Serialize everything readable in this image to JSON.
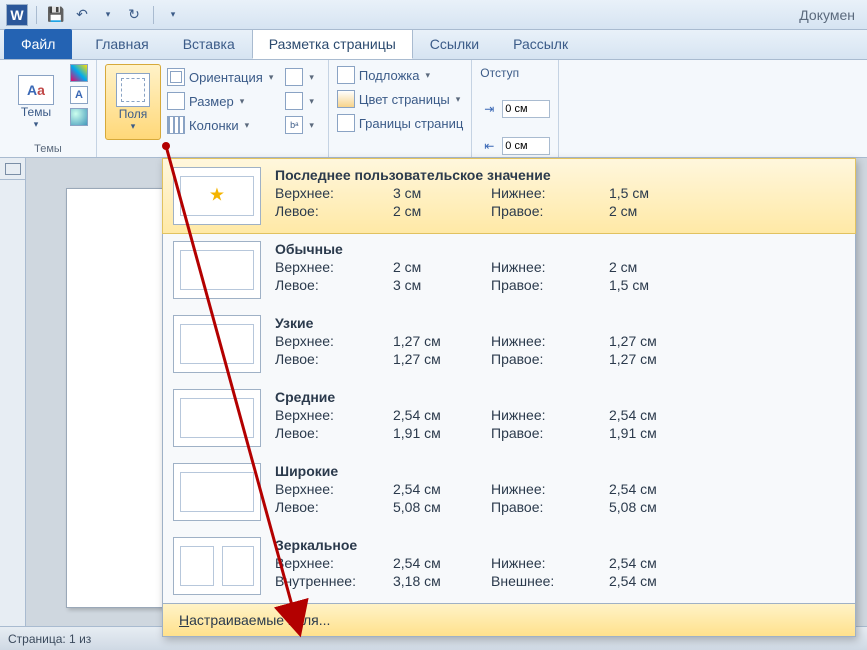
{
  "title": "Докумен",
  "tabs": {
    "file": "Файл",
    "home": "Главная",
    "insert": "Вставка",
    "layout": "Разметка страницы",
    "refs": "Ссылки",
    "mail": "Рассылк"
  },
  "ribbon": {
    "themes_group": "Темы",
    "themes_btn": "Темы",
    "margins_btn": "Поля",
    "orientation": "Ориентация",
    "size": "Размер",
    "columns": "Колонки",
    "watermark": "Подложка",
    "pagecolor": "Цвет страницы",
    "borders": "Границы страниц",
    "indent_label": "Отступ",
    "indent_left": "0 см",
    "indent_right": "0 см"
  },
  "dropdown": {
    "items": [
      {
        "title": "Последнее пользовательское значение",
        "top_l": "Верхнее:",
        "top_v": "3 см",
        "bot_l": "Нижнее:",
        "bot_v": "1,5 см",
        "left_l": "Левое:",
        "left_v": "2 см",
        "right_l": "Правое:",
        "right_v": "2 см"
      },
      {
        "title": "Обычные",
        "top_l": "Верхнее:",
        "top_v": "2 см",
        "bot_l": "Нижнее:",
        "bot_v": "2 см",
        "left_l": "Левое:",
        "left_v": "3 см",
        "right_l": "Правое:",
        "right_v": "1,5 см"
      },
      {
        "title": "Узкие",
        "top_l": "Верхнее:",
        "top_v": "1,27 см",
        "bot_l": "Нижнее:",
        "bot_v": "1,27 см",
        "left_l": "Левое:",
        "left_v": "1,27 см",
        "right_l": "Правое:",
        "right_v": "1,27 см"
      },
      {
        "title": "Средние",
        "top_l": "Верхнее:",
        "top_v": "2,54 см",
        "bot_l": "Нижнее:",
        "bot_v": "2,54 см",
        "left_l": "Левое:",
        "left_v": "1,91 см",
        "right_l": "Правое:",
        "right_v": "1,91 см"
      },
      {
        "title": "Широкие",
        "top_l": "Верхнее:",
        "top_v": "2,54 см",
        "bot_l": "Нижнее:",
        "bot_v": "2,54 см",
        "left_l": "Левое:",
        "left_v": "5,08 см",
        "right_l": "Правое:",
        "right_v": "5,08 см"
      },
      {
        "title": "Зеркальное",
        "top_l": "Верхнее:",
        "top_v": "2,54 см",
        "bot_l": "Нижнее:",
        "bot_v": "2,54 см",
        "left_l": "Внутреннее:",
        "left_v": "3,18 см",
        "right_l": "Внешнее:",
        "right_v": "2,54 см"
      }
    ],
    "custom": "Настраиваемые поля..."
  },
  "status": "Страница: 1 из"
}
